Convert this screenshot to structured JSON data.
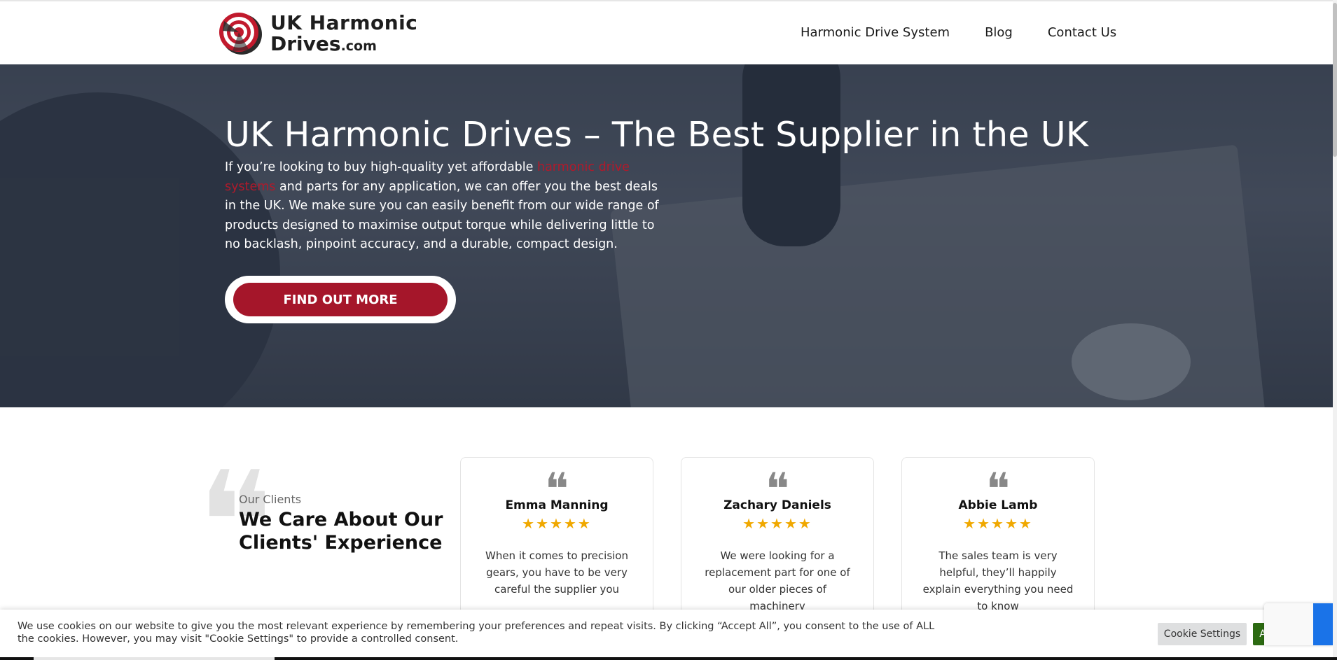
{
  "brand": {
    "line1": "UK Harmonic",
    "line2": "Drives",
    "suffix": ".com",
    "logo_icon": "harmonic-drive-logo-icon",
    "accent_color": "#a5162a"
  },
  "nav": {
    "items": [
      {
        "label": "Harmonic Drive System"
      },
      {
        "label": "Blog"
      },
      {
        "label": "Contact Us"
      }
    ]
  },
  "hero": {
    "title": "UK Harmonic Drives – The Best Supplier in the UK",
    "text_before": "If you’re looking to buy high-quality yet affordable ",
    "text_link": "harmonic drive systems",
    "text_after": " and parts for any application, we can offer you the best deals in the UK. We make sure you can easily benefit from our wide range of products designed to maximise output torque while delivering little to no backlash, pinpoint accuracy, and a durable, compact design.",
    "cta_label": "FIND OUT MORE"
  },
  "clients": {
    "kicker": "Our Clients",
    "title": "We Care About Our Clients' Experience",
    "quote_icon": "quote-mark-icon",
    "testimonials": [
      {
        "name": "Emma Manning",
        "stars": "★★★★★",
        "rating": 5,
        "text": "When it comes to precision gears, you have to be very careful the supplier you"
      },
      {
        "name": "Zachary Daniels",
        "stars": "★★★★★",
        "rating": 5,
        "text": "We were looking for a replacement part for one of our older pieces of machinery"
      },
      {
        "name": "Abbie Lamb",
        "stars": "★★★★★",
        "rating": 5,
        "text": "The sales team is very helpful, they’ll happily explain everything you need to know"
      }
    ]
  },
  "cookie": {
    "text": "We use cookies on our website to give you the most relevant experience by remembering your preferences and repeat visits. By clicking “Accept All”, you consent to the use of ALL the cookies. However, you may visit \"Cookie Settings\" to provide a controlled consent.",
    "settings_label": "Cookie Settings",
    "accept_label": "Accept All",
    "accept_color": "#2c6a12"
  }
}
